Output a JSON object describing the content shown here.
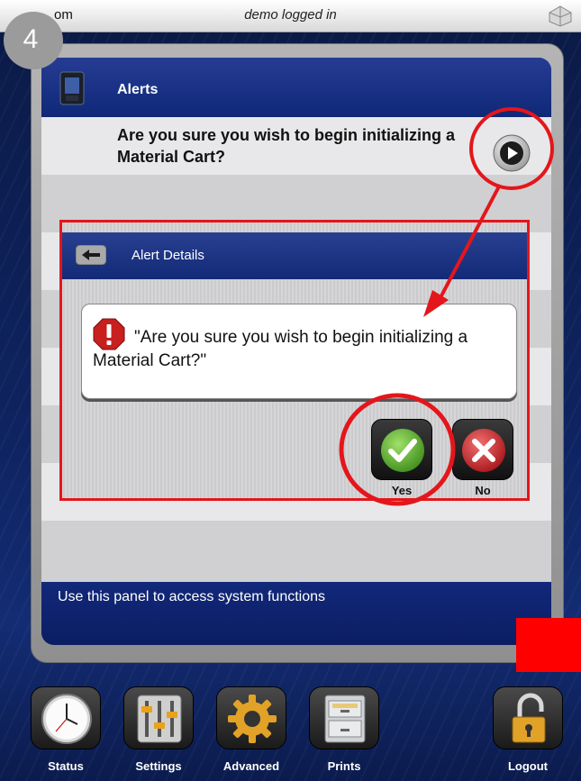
{
  "topbar": {
    "host_fragment": "om",
    "login_status": "demo logged in"
  },
  "annotation": {
    "step_number": "4"
  },
  "panel": {
    "title": "Alerts",
    "alert_message": "Are you sure you wish to begin initializing a Material Cart?",
    "footer_hint": "Use this panel to access system functions"
  },
  "alert_details": {
    "title": "Alert Details",
    "message": "\"Are you sure you wish to begin initializing a Material Cart?\"",
    "yes_label": "Yes",
    "no_label": "No"
  },
  "dock": {
    "status_label": "Status",
    "settings_label": "Settings",
    "advanced_label": "Advanced",
    "prints_label": "Prints",
    "logout_label": "Logout"
  },
  "colors": {
    "panel_blue": "#0c1f6a",
    "annotation_red": "#e4161b",
    "yes_green": "#5fae2e",
    "no_red": "#c8282c",
    "advanced_gold": "#e2a227"
  },
  "icons": [
    "3d-logo-icon",
    "printer-icon",
    "play-icon",
    "back-arrow-icon",
    "warning-icon",
    "checkmark-icon",
    "x-icon",
    "clock-icon",
    "sliders-icon",
    "gear-icon",
    "file-cabinet-icon",
    "padlock-icon"
  ]
}
